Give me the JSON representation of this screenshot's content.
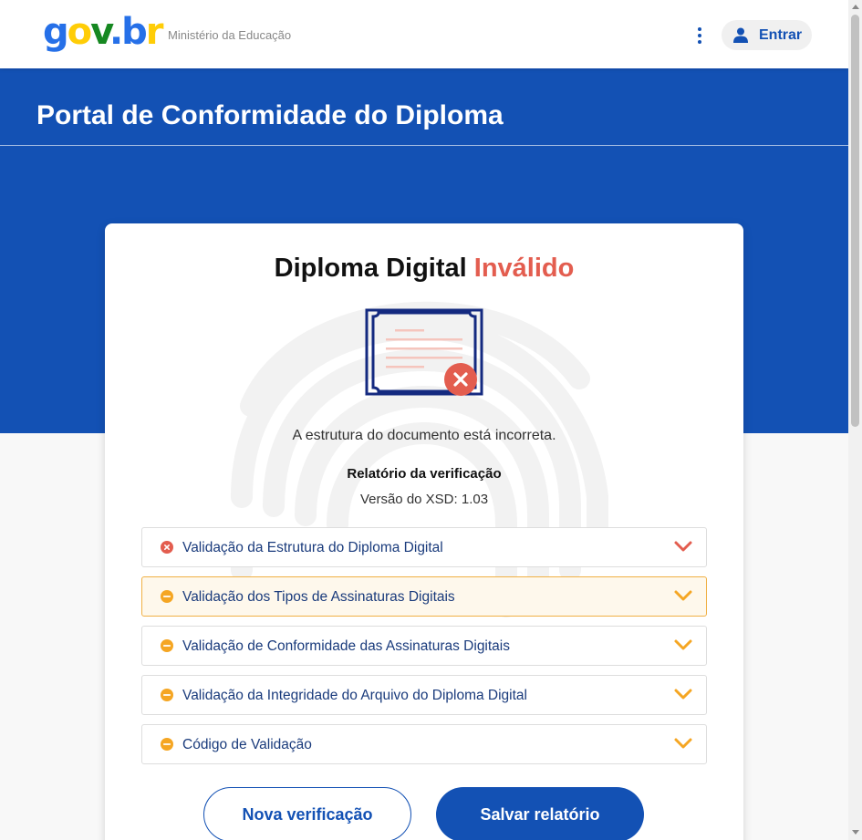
{
  "header": {
    "logo": {
      "g": "g",
      "o": "o",
      "v": "v",
      "dot": ".",
      "b": "b",
      "r": "r"
    },
    "ministry": "Ministério da Educação",
    "login_label": "Entrar"
  },
  "hero": {
    "title": "Portal de Conformidade do Diploma"
  },
  "result": {
    "title_part1": "Diploma Digital",
    "title_part2": "Inválido",
    "message": "A estrutura do documento está incorreta.",
    "report_title": "Relatório da verificação",
    "xsd_version": "Versão do XSD: 1.03"
  },
  "accordions": [
    {
      "label": "Validação da Estrutura do Diploma Digital",
      "status": "error"
    },
    {
      "label": "Validação dos Tipos de Assinaturas Digitais",
      "status": "warning"
    },
    {
      "label": "Validação de Conformidade das Assinaturas Digitais",
      "status": "warning"
    },
    {
      "label": "Validação da Integridade do Arquivo do Diploma Digital",
      "status": "warning"
    },
    {
      "label": "Código de Validação",
      "status": "warning"
    }
  ],
  "buttons": {
    "new_check": "Nova verificação",
    "save_report": "Salvar relatório"
  },
  "colors": {
    "primary": "#1351b4",
    "invalid": "#e35d4f",
    "warning": "#f5a623",
    "error": "#e35d4f"
  }
}
